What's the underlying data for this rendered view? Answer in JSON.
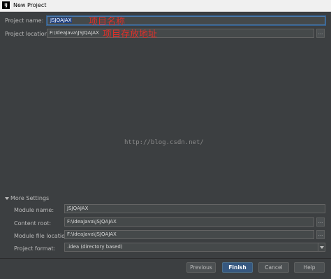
{
  "window": {
    "title": "New Project",
    "icon": "intellij-icon"
  },
  "form": {
    "project_name_label": "Project name:",
    "project_name_value": "JSJQAJAX",
    "project_location_label": "Project location:",
    "project_location_value": "F:\\IdeaJava\\JSJQAJAX",
    "browse_label": "..."
  },
  "annotations": {
    "name_note": "项目名称",
    "location_note": "项目存放地址",
    "watermark": "http://blog.csdn.net/"
  },
  "more_settings": {
    "toggle_label": "More Settings",
    "module_name_label": "Module name:",
    "module_name_value": "JSJQAJAX",
    "content_root_label": "Content root:",
    "content_root_value": "F:\\IdeaJava\\JSJQAJAX",
    "module_file_location_label": "Module file location:",
    "module_file_location_value": "F:\\IdeaJava\\JSJQAJAX",
    "project_format_label": "Project format:",
    "project_format_value": ".idea (directory based)"
  },
  "buttons": {
    "previous": "Previous",
    "finish": "Finish",
    "cancel": "Cancel",
    "help": "Help"
  },
  "colors": {
    "background": "#3c3f41",
    "field_background": "#45494a",
    "focus_border": "#4a7bb0",
    "annotation_red": "#e0302a",
    "primary_button": "#365880"
  }
}
